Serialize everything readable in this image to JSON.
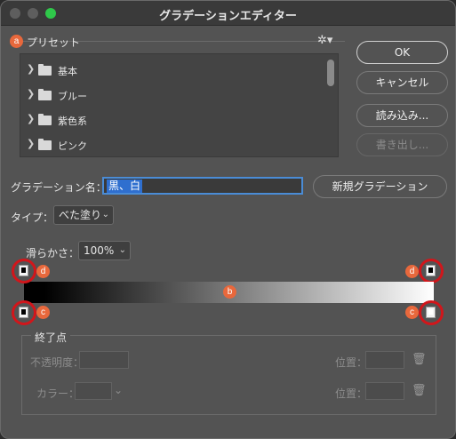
{
  "window": {
    "title": "グラデーションエディター"
  },
  "badges": {
    "a": "a",
    "b": "b",
    "c": "c",
    "d": "d"
  },
  "presets": {
    "label": "プリセット",
    "items": [
      {
        "label": "基本"
      },
      {
        "label": "ブルー"
      },
      {
        "label": "紫色系"
      },
      {
        "label": "ピンク"
      }
    ]
  },
  "buttons": {
    "ok": "OK",
    "cancel": "キャンセル",
    "load": "読み込み...",
    "export": "書き出し...",
    "new_gradient": "新規グラデーション"
  },
  "name": {
    "label": "グラデーション名：",
    "value": "黒、白"
  },
  "type": {
    "label": "タイプ：",
    "value": "べた塗り"
  },
  "smoothness": {
    "label": "滑らかさ：",
    "value": "100%"
  },
  "endpoint": {
    "title": "終了点",
    "opacity_label": "不透明度：",
    "color_label": "カラー：",
    "location_label_1": "位置：",
    "location_label_2": "位置："
  },
  "gradient": {
    "start_color": "#000000",
    "end_color": "#ffffff"
  },
  "icons": [
    "gear-icon",
    "chevron-right-icon",
    "folder-icon",
    "chevron-down-icon",
    "trash-icon"
  ]
}
